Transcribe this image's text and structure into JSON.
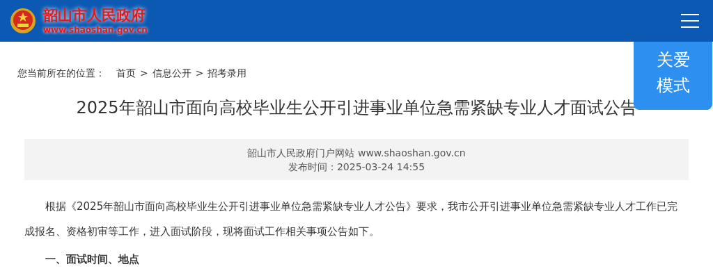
{
  "header": {
    "site_name": "韶山市人民政府",
    "site_url": "www.shaoshan.gov.cn"
  },
  "care_mode": {
    "lines": [
      "关爱",
      "模式"
    ]
  },
  "breadcrumb": {
    "label": "您当前所在的位置：",
    "items": [
      "首页",
      "信息公开",
      "招考录用"
    ],
    "separator": ">"
  },
  "article": {
    "title": "2025年韶山市面向高校毕业生公开引进事业单位急需紧缺专业人才面试公告",
    "source": "韶山市人民政府门户网站 www.shaoshan.gov.cn",
    "published": "发布时间：2025-03-24 14:55",
    "paragraphs": [
      "根据《2025年韶山市面向高校毕业生公开引进事业单位急需紧缺专业人才公告》要求，我市公开引进事业单位急需紧缺专业人才工作已完成报名、资格初审等工作，进入面试阶段，现将面试工作相关事项公告如下。"
    ],
    "section_heading": "一、面试时间、地点"
  }
}
